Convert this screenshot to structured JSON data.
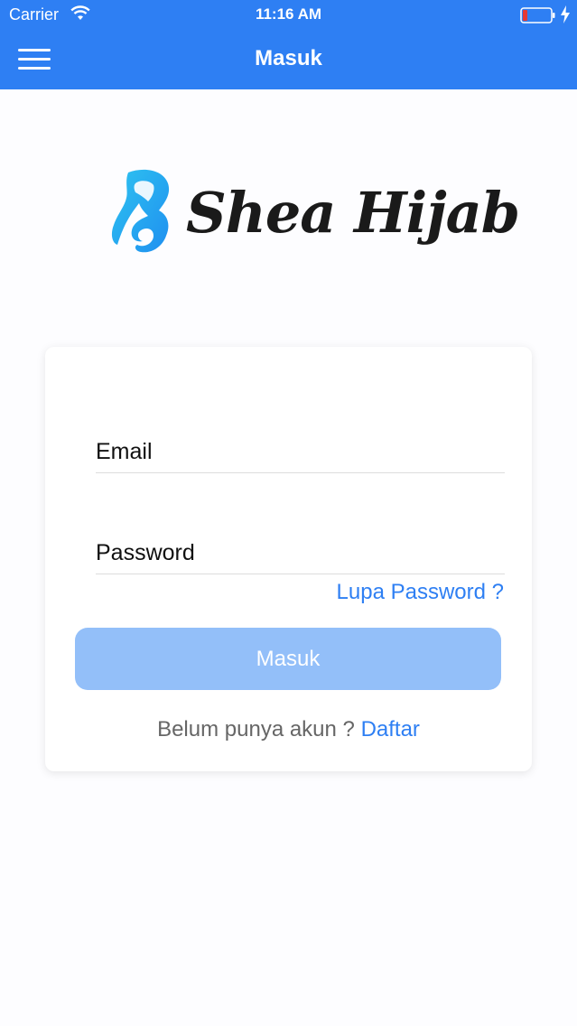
{
  "status_bar": {
    "carrier": "Carrier",
    "time": "11:16 AM"
  },
  "nav": {
    "title": "Masuk",
    "menu_icon": "hamburger-menu-icon"
  },
  "logo": {
    "text": "Shea Hijab",
    "icon": "hijab-woman-icon",
    "icon_color": "#2aa9f0"
  },
  "form": {
    "email_placeholder": "Email",
    "email_value": "",
    "password_placeholder": "Password",
    "password_value": "",
    "forgot_password": "Lupa Password ?",
    "submit_label": "Masuk",
    "signup_prompt": "Belum punya akun ?",
    "signup_link": "Daftar"
  },
  "colors": {
    "header": "#2e7ff3",
    "accent": "#2e7ff3",
    "button_disabled": "#93bff9",
    "battery_low": "#e53935"
  }
}
